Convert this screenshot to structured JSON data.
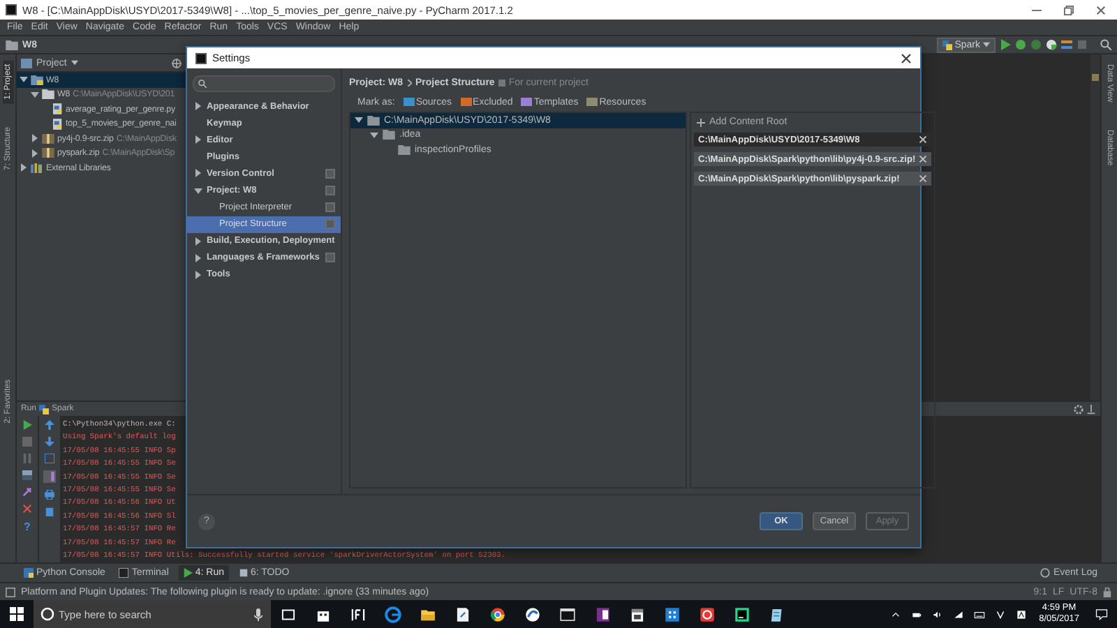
{
  "window": {
    "title": "W8 - [C:\\MainAppDisk\\USYD\\2017-5349\\W8] - ...\\top_5_movies_per_genre_naive.py - PyCharm 2017.1.2"
  },
  "menu": [
    "File",
    "Edit",
    "View",
    "Navigate",
    "Code",
    "Refactor",
    "Run",
    "Tools",
    "VCS",
    "Window",
    "Help"
  ],
  "navigation_bar": {
    "breadcrumb": "W8",
    "run_config": "Spark"
  },
  "left_stripe": [
    {
      "label": "1: Project",
      "selected": true
    },
    {
      "label": "7: Structure",
      "selected": false
    },
    {
      "label": "2: Favorites",
      "selected": false
    }
  ],
  "right_stripe": [
    "Data View",
    "Database"
  ],
  "project_panel": {
    "title": "Project",
    "tree": [
      {
        "label": "W8",
        "kind": "project",
        "selected": true,
        "expanded": true,
        "children": [
          {
            "label": "W8",
            "path": "C:\\MainAppDisk\\USYD\\201",
            "kind": "folder",
            "selected": false,
            "expanded": true,
            "children": [
              {
                "label": "average_rating_per_genre.py",
                "kind": "python",
                "selected": false
              },
              {
                "label": "top_5_movies_per_genre_nai",
                "kind": "python",
                "selected": false
              }
            ]
          },
          {
            "label": "py4j-0.9-src.zip",
            "path": "C:\\MainAppDisk",
            "kind": "archive",
            "selected": false,
            "expanded": false
          },
          {
            "label": "pyspark.zip",
            "path": "C:\\MainAppDisk\\Sp",
            "kind": "archive",
            "selected": false,
            "expanded": false
          }
        ]
      },
      {
        "label": "External Libraries",
        "kind": "library",
        "selected": false,
        "expanded": false
      }
    ]
  },
  "run_panel": {
    "title": "Run",
    "config": "Spark",
    "help": "?",
    "lines": [
      {
        "text": "C:\\Python34\\python.exe C:",
        "kind": "command"
      },
      {
        "text": "Using Spark's default log",
        "kind": "error"
      },
      {
        "text": "17/05/08 16:45:55 INFO Sp",
        "kind": "error"
      },
      {
        "text": "17/05/08 16:45:55 INFO Se",
        "kind": "error"
      },
      {
        "text": "17/05/08 16:45:55 INFO Se",
        "kind": "error"
      },
      {
        "text": "17/05/08 16:45:55 INFO Se",
        "kind": "error"
      },
      {
        "text": "17/05/08 16:45:56 INFO Ut",
        "kind": "error"
      },
      {
        "text": "17/05/08 16:45:56 INFO Sl",
        "kind": "error"
      },
      {
        "text": "17/05/08 16:45:57 INFO Re",
        "kind": "error"
      },
      {
        "text": "17/05/08 16:45:57 INFO Re",
        "kind": "error"
      },
      {
        "text": "17/05/08 16:45:57 INFO Utils: Successfully started service 'sparkDriverActorSystem' on port 52303.",
        "kind": "error"
      }
    ]
  },
  "tool_tabs": [
    {
      "label": "Python Console",
      "selected": false
    },
    {
      "label": "Terminal",
      "selected": false
    },
    {
      "label": "4: Run",
      "selected": true
    },
    {
      "label": "6: TODO",
      "selected": false
    }
  ],
  "event_log": "Event Log",
  "status_bar": {
    "message": "Platform and Plugin Updates: The following plugin is ready to update: .ignore (33 minutes ago)",
    "position": "9:1",
    "line_separator": "LF",
    "encoding": "UTF-8"
  },
  "taskbar": {
    "search_placeholder": "Type here to search",
    "time": "4:59 PM",
    "date": "8/05/2017"
  },
  "dialog": {
    "title": "Settings",
    "help": "?",
    "nav": [
      {
        "label": "Appearance & Behavior",
        "kind": "group",
        "expanded": false,
        "selected": false,
        "project_level": false
      },
      {
        "label": "Keymap",
        "kind": "page",
        "selected": false,
        "project_level": false
      },
      {
        "label": "Editor",
        "kind": "group",
        "expanded": false,
        "selected": false,
        "project_level": false
      },
      {
        "label": "Plugins",
        "kind": "page",
        "selected": false,
        "project_level": false
      },
      {
        "label": "Version Control",
        "kind": "group",
        "expanded": false,
        "selected": false,
        "project_level": true
      },
      {
        "label": "Project: W8",
        "kind": "group",
        "expanded": true,
        "selected": false,
        "project_level": true,
        "children": [
          {
            "label": "Project Interpreter",
            "kind": "page",
            "selected": false,
            "project_level": true
          },
          {
            "label": "Project Structure",
            "kind": "page",
            "selected": true,
            "project_level": true
          }
        ]
      },
      {
        "label": "Build, Execution, Deployment",
        "kind": "group",
        "expanded": false,
        "selected": false,
        "project_level": false
      },
      {
        "label": "Languages & Frameworks",
        "kind": "group",
        "expanded": false,
        "selected": false,
        "project_level": true
      },
      {
        "label": "Tools",
        "kind": "group",
        "expanded": false,
        "selected": false,
        "project_level": false
      }
    ],
    "breadcrumb": [
      "Project: W8",
      "Project Structure"
    ],
    "scope_note": "For current project",
    "mark_as": {
      "label": "Mark as:",
      "options": [
        {
          "label": "Sources",
          "color": "#3b8fcc"
        },
        {
          "label": "Excluded",
          "color": "#d06a2a"
        },
        {
          "label": "Templates",
          "color": "#9a7fd6"
        },
        {
          "label": "Resources",
          "color": "#8f8a74"
        }
      ]
    },
    "directory_tree": [
      {
        "label": "C:\\MainAppDisk\\USYD\\2017-5349\\W8",
        "selected": true,
        "expanded": true,
        "children": [
          {
            "label": ".idea",
            "selected": false,
            "expanded": true,
            "children": [
              {
                "label": "inspectionProfiles",
                "selected": false
              }
            ]
          }
        ]
      }
    ],
    "content_roots": {
      "add_label": "Add Content Root",
      "roots": [
        {
          "path": "C:\\MainAppDisk\\USYD\\2017-5349\\W8",
          "selected": true
        },
        {
          "path": "C:\\MainAppDisk\\Spark\\python\\lib\\py4j-0.9-src.zip!",
          "selected": false
        },
        {
          "path": "C:\\MainAppDisk\\Spark\\python\\lib\\pyspark.zip!",
          "selected": false
        }
      ]
    },
    "buttons": [
      {
        "label": "OK",
        "kind": "default"
      },
      {
        "label": "Cancel",
        "kind": "normal"
      },
      {
        "label": "Apply",
        "kind": "disabled"
      }
    ]
  }
}
